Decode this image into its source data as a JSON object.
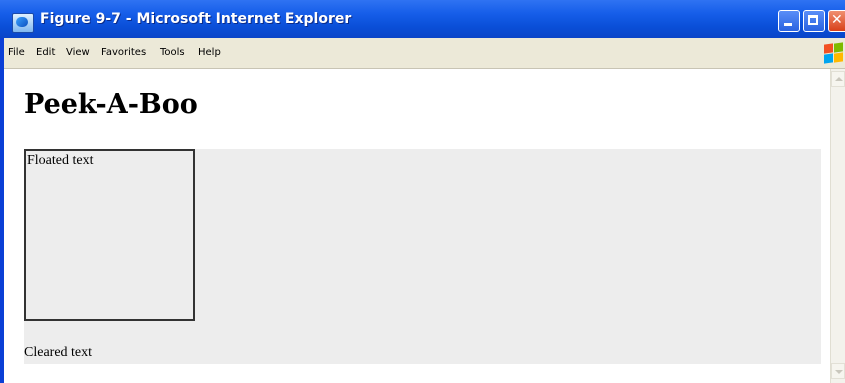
{
  "window": {
    "title": "Figure 9-7 - Microsoft Internet Explorer"
  },
  "menubar": {
    "items": [
      "File",
      "Edit",
      "View",
      "Favorites",
      "Tools",
      "Help"
    ]
  },
  "page": {
    "heading": "Peek-A-Boo",
    "floated_text": "Floated text",
    "cleared_text": "Cleared text"
  },
  "colors": {
    "titlebar": "#0a4fd8",
    "menubar": "#ece9d8",
    "block_background": "#ededed",
    "float_border": "#333333"
  }
}
